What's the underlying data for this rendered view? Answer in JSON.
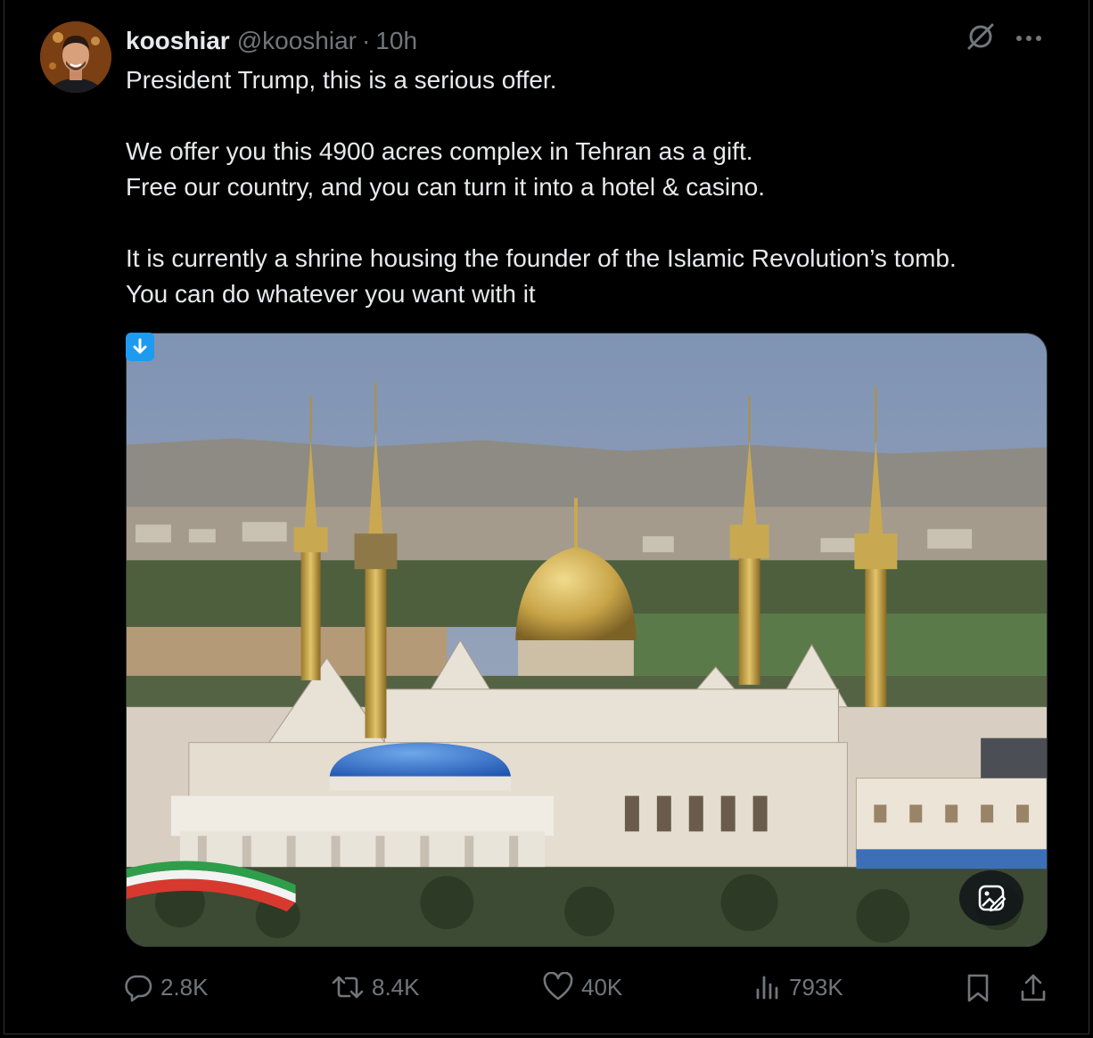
{
  "author": {
    "name": "kooshiar",
    "handle": "@kooshiar",
    "separator": "·",
    "time": "10h"
  },
  "tweet": {
    "paragraphs": [
      [
        "President Trump, this is a serious offer."
      ],
      [
        "We offer you this 4900 acres complex in Tehran as a gift.",
        "Free our country, and you can turn it into a hotel & casino."
      ],
      [
        "It is currently a shrine housing the founder of the Islamic Revolution’s tomb.",
        "You can do whatever you want with it"
      ]
    ]
  },
  "icons": {
    "grok": "grok-icon",
    "more": "more-icon",
    "download": "download-arrow-icon",
    "alt": "image-edit-icon",
    "reply": "reply-icon",
    "retweet": "retweet-icon",
    "like": "heart-icon",
    "views": "views-icon",
    "bookmark": "bookmark-icon",
    "share": "share-icon"
  },
  "stats": {
    "replies": "2.8K",
    "retweets": "8.4K",
    "likes": "40K",
    "views": "793K"
  },
  "colors": {
    "background": "#000000",
    "text": "#e7e9ea",
    "muted": "#71767b",
    "accent": "#1d9bf0"
  }
}
